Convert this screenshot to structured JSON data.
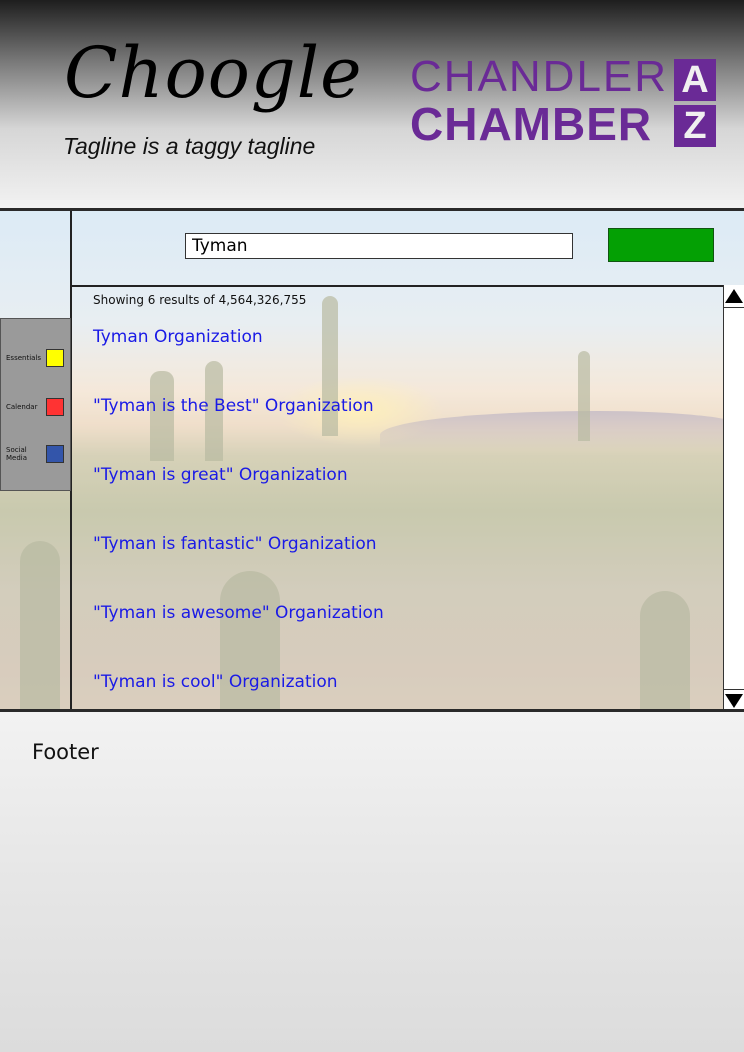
{
  "header": {
    "logo": "Choogle",
    "tagline": "Tagline is a taggy tagline",
    "brand": {
      "line1": "CHANDLER",
      "line2": "CHAMBER",
      "box_top": "A",
      "box_bottom": "Z",
      "color": "#6a2a96"
    }
  },
  "search": {
    "value": "Tyman",
    "button_color": "#04a004"
  },
  "sidebar": {
    "items": [
      {
        "label": "Essentials",
        "color": "#ffff00",
        "icon": "yellow-square"
      },
      {
        "label": "Calendar",
        "color": "#ff3333",
        "icon": "red-square"
      },
      {
        "label": "Social Media",
        "color": "#3355aa",
        "icon": "blue-square"
      }
    ]
  },
  "results": {
    "count_text": "Showing 6 results of 4,564,326,755",
    "items": [
      "Tyman Organization",
      "\"Tyman is the Best\" Organization",
      "\"Tyman is great\" Organization",
      "\"Tyman is fantastic\" Organization",
      "\"Tyman is awesome\" Organization",
      "\"Tyman is cool\" Organization"
    ],
    "link_color": "#1a1ae6"
  },
  "scrollbar": {
    "up_icon": "triangle-up-icon",
    "down_icon": "triangle-down-icon"
  },
  "footer": {
    "text": "Footer"
  }
}
